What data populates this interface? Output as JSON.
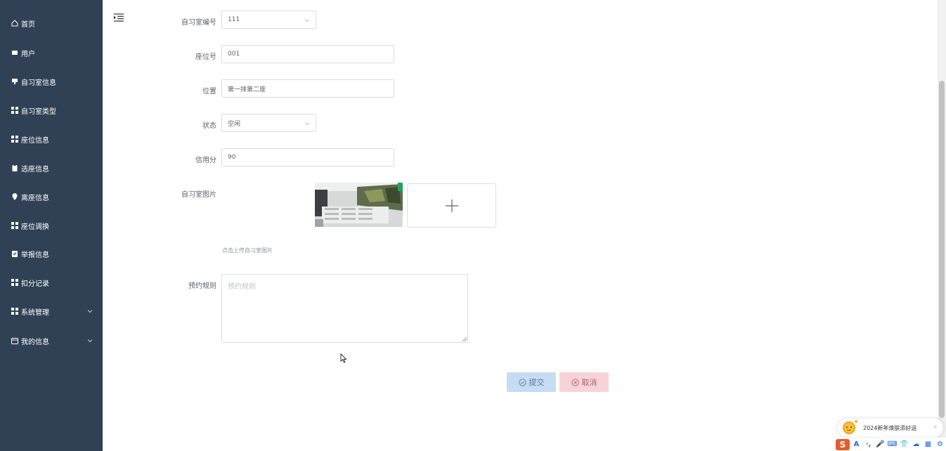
{
  "sidebar": {
    "items": [
      {
        "label": "首页",
        "icon": "home-icon"
      },
      {
        "label": "用户",
        "icon": "user-icon"
      },
      {
        "label": "自习室信息",
        "icon": "room-icon"
      },
      {
        "label": "自习室类型",
        "icon": "grid-icon"
      },
      {
        "label": "座位信息",
        "icon": "grid-icon"
      },
      {
        "label": "选座信息",
        "icon": "clipboard-icon"
      },
      {
        "label": "离座信息",
        "icon": "location-icon"
      },
      {
        "label": "座位调换",
        "icon": "grid-icon"
      },
      {
        "label": "举报信息",
        "icon": "report-icon"
      },
      {
        "label": "扣分记录",
        "icon": "grid-icon"
      },
      {
        "label": "系统管理",
        "icon": "grid-icon",
        "expandable": true
      },
      {
        "label": "我的信息",
        "icon": "calendar-icon",
        "expandable": true
      }
    ]
  },
  "form": {
    "room_no": {
      "label": "自习室编号",
      "value": "111"
    },
    "seat_no": {
      "label": "座位号",
      "value": "001"
    },
    "location": {
      "label": "位置",
      "value": "第一排第二座"
    },
    "status": {
      "label": "状态",
      "value": "空闲"
    },
    "credit": {
      "label": "信用分",
      "value": "90"
    },
    "room_image": {
      "label": "自习室图片",
      "tip": "点击上传自习室图片"
    },
    "rules": {
      "label": "预约规则",
      "placeholder": "预约规则"
    }
  },
  "buttons": {
    "submit": "提交",
    "cancel": "取消"
  },
  "ime": {
    "popup_text": "2024新年焕肤添好运",
    "close": "×",
    "logo": "S",
    "tools": [
      "A",
      "·,",
      "🎤",
      "⌨",
      "👕",
      "☁",
      "▦",
      "⚙"
    ]
  },
  "colors": {
    "sidebar_bg": "#304156",
    "submit_bg": "#c6dcf3",
    "cancel_bg": "#f7d3d9"
  }
}
